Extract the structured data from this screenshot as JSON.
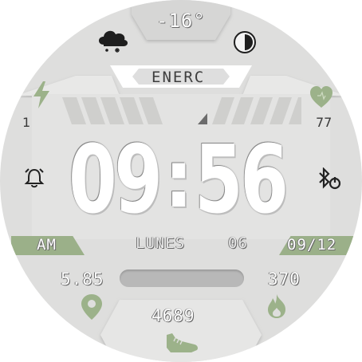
{
  "weather": {
    "temperature": "-16°",
    "icon": "cloud-snow-icon"
  },
  "energy_label": "ENERC",
  "battery": {
    "value": "1",
    "icon": "lightning-icon"
  },
  "heart_rate": {
    "value": "77",
    "icon": "heart-icon"
  },
  "time": {
    "hours": "09",
    "minutes": "56",
    "separator": ":"
  },
  "ampm": "AM",
  "day": "LUNES",
  "day_number": "06",
  "date": "09/12",
  "distance": "5.85",
  "calories": "370",
  "steps": "4689",
  "colors": {
    "accent_green": "#8fa77c",
    "background": "#dededd",
    "bar": "#b8b8b8"
  },
  "icons": [
    "cloud-snow-icon",
    "contrast-icon",
    "lightning-icon",
    "heart-icon",
    "alarm-bell-icon",
    "bluetooth-icon",
    "location-pin-icon",
    "flame-icon",
    "shoe-icon"
  ]
}
